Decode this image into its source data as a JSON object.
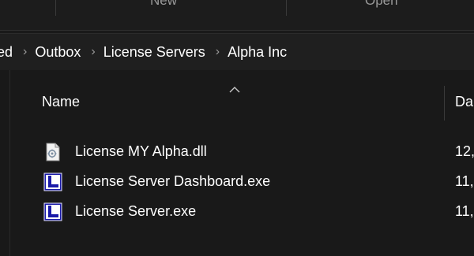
{
  "ribbon": {
    "new_label": "New",
    "open_label": "Open"
  },
  "address": {
    "crumbs": [
      "ed",
      "Outbox",
      "License Servers",
      "Alpha Inc"
    ],
    "separator": "›"
  },
  "columns": {
    "name": "Name",
    "date": "Da"
  },
  "files": [
    {
      "name": "License MY Alpha.dll",
      "date": "12,",
      "icon": "dll-file-icon"
    },
    {
      "name": "License Server Dashboard.exe",
      "date": "11,",
      "icon": "exe-application-icon"
    },
    {
      "name": "License Server.exe",
      "date": "11,",
      "icon": "exe-application-icon"
    }
  ],
  "colors": {
    "background": "#191919",
    "address_bar": "#1f1f1f",
    "text": "#ffffff",
    "muted": "#9a9a9a",
    "exe_icon_blue": "#1a1aa8"
  }
}
